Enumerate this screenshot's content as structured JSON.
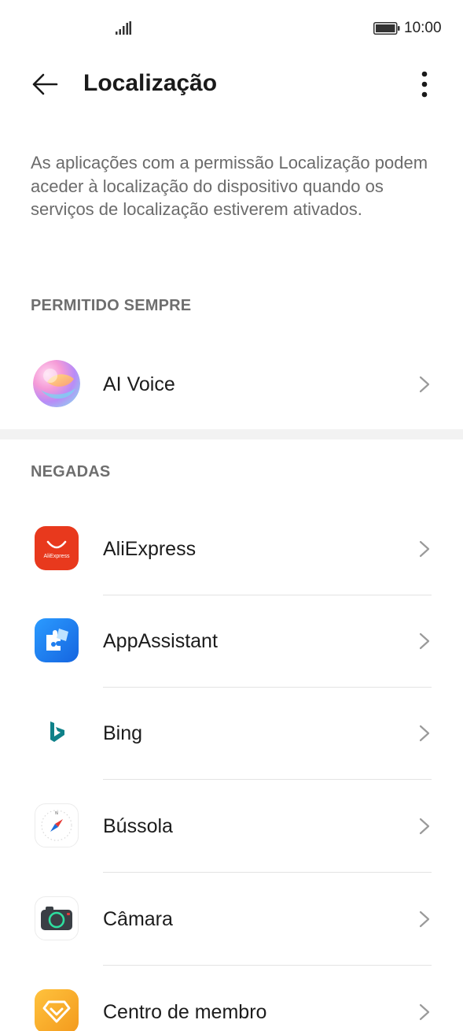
{
  "status_bar": {
    "time": "10:00",
    "signal_icon": "signal-bars-icon",
    "battery_icon": "battery-full-icon"
  },
  "header": {
    "title": "Localização",
    "back_icon": "arrow-back-icon",
    "more_icon": "more-vertical-icon"
  },
  "description": "As aplicações com a permissão Localização podem aceder à localização do dispositivo quando os serviços de localização estiverem ativados.",
  "sections": {
    "allowed_always": {
      "title": "PERMITIDO SEMPRE",
      "items": [
        {
          "label": "AI Voice",
          "icon": "ai-voice-icon"
        }
      ]
    },
    "denied": {
      "title": "NEGADAS",
      "items": [
        {
          "label": "AliExpress",
          "icon": "aliexpress-icon",
          "icon_text": "AliExpress",
          "color": "#e8391d"
        },
        {
          "label": "AppAssistant",
          "icon": "app-assistant-icon",
          "color": "#1e7ef0"
        },
        {
          "label": "Bing",
          "icon": "bing-icon",
          "color": "#0f8189"
        },
        {
          "label": "Bússola",
          "icon": "compass-icon"
        },
        {
          "label": "Câmara",
          "icon": "camera-icon"
        },
        {
          "label": "Centro de membro",
          "icon": "member-center-icon",
          "color": "#f6a623"
        }
      ]
    }
  },
  "chevron_icon": "chevron-right-icon"
}
